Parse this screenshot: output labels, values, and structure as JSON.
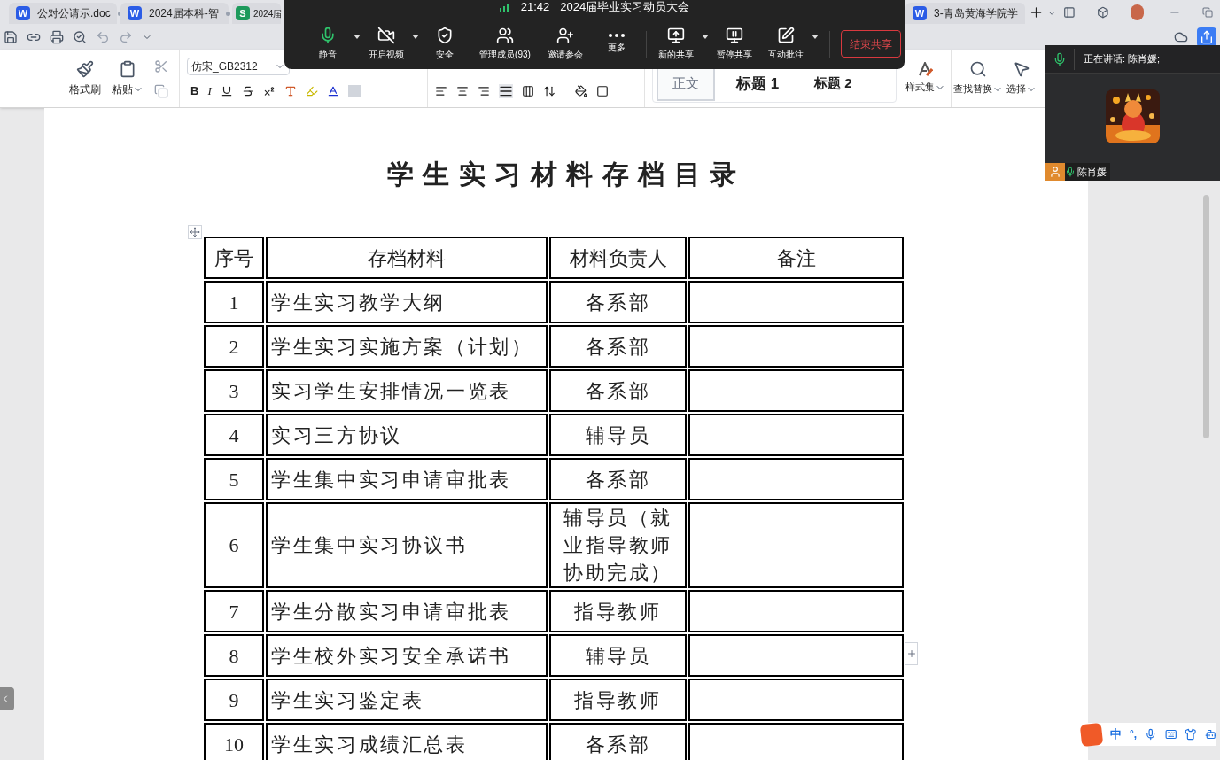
{
  "tabs": [
    {
      "badge": "W",
      "color": "#2b5ce6",
      "label": "公对公请示.doc"
    },
    {
      "badge": "W",
      "color": "#2b5ce6",
      "label": "2024届本科-智"
    },
    {
      "badge": "S",
      "color": "#1d9a5b",
      "label": "2024届"
    },
    {
      "badge": "W",
      "color": "#2b5ce6",
      "label": "3-青岛黄海学院学"
    }
  ],
  "ribbon": {
    "clipboard": [
      {
        "label": "格式刷",
        "menu": false
      },
      {
        "label": "粘贴",
        "menu": true
      }
    ],
    "font": {
      "value": "仿宋_GB2312"
    },
    "bold": "B",
    "italic": "I",
    "styles": [
      {
        "label": "正文",
        "selected": true
      },
      {
        "label": "标题 1",
        "selected": false
      },
      {
        "label": "标题 2",
        "selected": false
      }
    ],
    "tools": [
      {
        "label": "样式集",
        "menu": true
      },
      {
        "label": "查找替换",
        "menu": true
      },
      {
        "label": "选择",
        "menu": true
      }
    ]
  },
  "meeting": {
    "time": "21:42",
    "title": "2024届毕业实习动员大会",
    "buttons": [
      {
        "label": "静音",
        "kind": "mic",
        "menu": true
      },
      {
        "label": "开启视频",
        "kind": "video",
        "menu": true
      },
      {
        "label": "安全",
        "kind": "shield",
        "menu": false
      },
      {
        "label": "管理成员(93)",
        "kind": "members",
        "menu": false
      },
      {
        "label": "邀请参会",
        "kind": "invite",
        "menu": false
      },
      {
        "label": "更多",
        "kind": "more",
        "menu": false
      },
      {
        "label": "新的共享",
        "kind": "share",
        "menu": true
      },
      {
        "label": "暂停共享",
        "kind": "pause",
        "menu": false
      },
      {
        "label": "互动批注",
        "kind": "annotate",
        "menu": true
      }
    ],
    "end_button": "结束共享"
  },
  "video_panel": {
    "speaking": "正在讲话: 陈肖媛;",
    "name": "陈肖媛"
  },
  "document": {
    "title": "学生实习材料存档目录",
    "columns": [
      "序号",
      "存档材料",
      "材料负责人",
      "备注"
    ],
    "rows": [
      {
        "no": "1",
        "material": "学生实习教学大纲",
        "owner": "各系部"
      },
      {
        "no": "2",
        "material": "学生实习实施方案（计划）",
        "owner": "各系部"
      },
      {
        "no": "3",
        "material": "实习学生安排情况一览表",
        "owner": "各系部"
      },
      {
        "no": "4",
        "material": "实习三方协议",
        "owner": "辅导员"
      },
      {
        "no": "5",
        "material": "学生集中实习申请审批表",
        "owner": "各系部"
      },
      {
        "no": "6",
        "material": "学生集中实习协议书",
        "owner": "辅导员（就业指导教师协助完成）"
      },
      {
        "no": "7",
        "material": "学生分散实习申请审批表",
        "owner": "指导教师"
      },
      {
        "no": "8",
        "material": "学生校外实习安全承诺书",
        "owner": "辅导员"
      },
      {
        "no": "9",
        "material": "学生实习鉴定表",
        "owner": "指导教师"
      },
      {
        "no": "10",
        "material": "学生实习成绩汇总表",
        "owner": "各系部"
      }
    ]
  },
  "ime": {
    "mode": "中",
    "punct": "°,"
  }
}
